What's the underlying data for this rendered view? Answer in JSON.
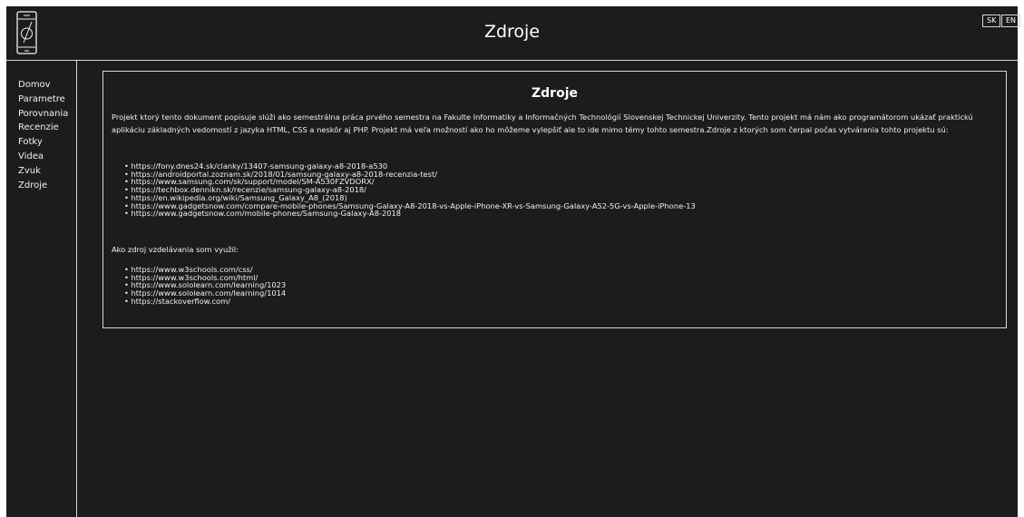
{
  "header": {
    "title": "Zdroje",
    "logo_icon": "smartphone-logo-icon",
    "languages": [
      "SK",
      "EN"
    ]
  },
  "sidebar": {
    "items": [
      {
        "label": "Domov"
      },
      {
        "label": "Parametre"
      },
      {
        "label": "Porovnania"
      },
      {
        "label": "Recenzie"
      },
      {
        "label": "Fotky"
      },
      {
        "label": "Videa"
      },
      {
        "label": "Zvuk"
      },
      {
        "label": "Zdroje"
      }
    ]
  },
  "main": {
    "title": "Zdroje",
    "intro": "Projekt ktorý tento dokument popisuje slúži ako semestrálna práca prvého semestra na Fakulte Informatiky a Informačných Technológií Slovenskej Technickej Univerzity. Tento projekt má nám ako programátorom ukázať praktickú aplikáciu základných vedomostí z jazyka HTML, CSS a neskôr aj PHP. Projekt má veľa možností ako ho môžeme vylepšiť ale to ide mimo témy tohto semestra.Zdroje z ktorých som čerpal počas vytvárania tohto projektu sú:",
    "sources": [
      "https://fony.dnes24.sk/clanky/13407-samsung-galaxy-a8-2018-a530",
      "https://androidportal.zoznam.sk/2018/01/samsung-galaxy-a8-2018-recenzia-test/",
      "https://www.samsung.com/sk/support/model/SM-A530FZVDORX/",
      "https://techbox.dennikn.sk/recenzie/samsung-galaxy-a8-2018/",
      "https://en.wikipedia.org/wiki/Samsung_Galaxy_A8_(2018)",
      "https://www.gadgetsnow.com/compare-mobile-phones/Samsung-Galaxy-A8-2018-vs-Apple-iPhone-XR-vs-Samsung-Galaxy-A52-5G-vs-Apple-iPhone-13",
      "https://www.gadgetsnow.com/mobile-phones/Samsung-Galaxy-A8-2018"
    ],
    "learning_label": "Ako zdroj vzdelávania som využil:",
    "learning_sources": [
      "https://www.w3schools.com/css/",
      "https://www.w3schools.com/html/",
      "https://www.sololearn.com/learning/1023",
      "https://www.sololearn.com/learning/1014",
      "https://stackoverflow.com/"
    ]
  },
  "colors": {
    "background": "#1c1b1d",
    "text": "#f2f2f2",
    "border": "#d8d8d8"
  }
}
